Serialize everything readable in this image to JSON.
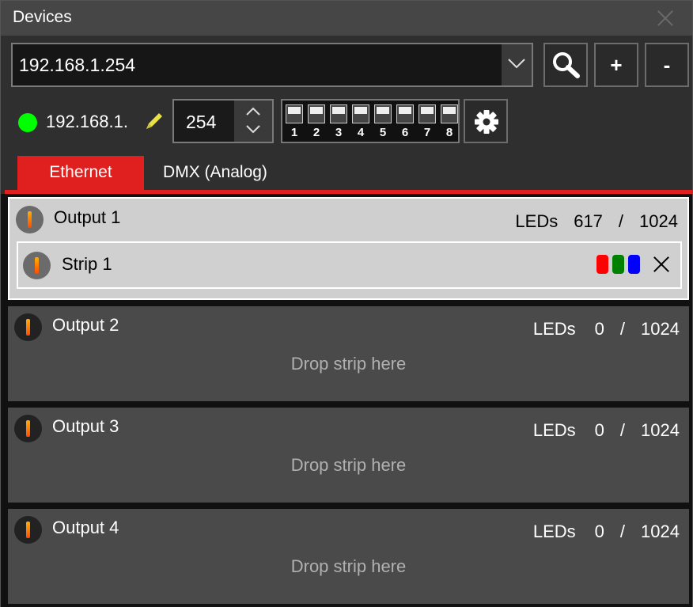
{
  "window": {
    "title": "Devices"
  },
  "device": {
    "ip_selected": "192.168.1.254",
    "ip_prefix": "192.168.1.",
    "ip_last_octet": "254",
    "status_color": "#00ff00",
    "buttons": {
      "search_icon": "magnifier-icon",
      "add_label": "+",
      "remove_label": "-"
    },
    "dip_switches": [
      "1",
      "2",
      "3",
      "4",
      "5",
      "6",
      "7",
      "8"
    ]
  },
  "tabs": [
    {
      "label": "Ethernet",
      "active": true
    },
    {
      "label": "DMX (Analog)",
      "active": false
    }
  ],
  "leds_label": "LEDs",
  "separator": "/",
  "drop_hint": "Drop strip here",
  "outputs": [
    {
      "name": "Output 1",
      "used": "617",
      "total": "1024",
      "selected": true,
      "strips": [
        {
          "name": "Strip 1",
          "colors": [
            "#ff0000",
            "#008000",
            "#0000ff"
          ]
        }
      ]
    },
    {
      "name": "Output 2",
      "used": "0",
      "total": "1024",
      "selected": false,
      "strips": []
    },
    {
      "name": "Output 3",
      "used": "0",
      "total": "1024",
      "selected": false,
      "strips": []
    },
    {
      "name": "Output 4",
      "used": "0",
      "total": "1024",
      "selected": false,
      "strips": []
    }
  ],
  "accent_color": "#e0201f"
}
